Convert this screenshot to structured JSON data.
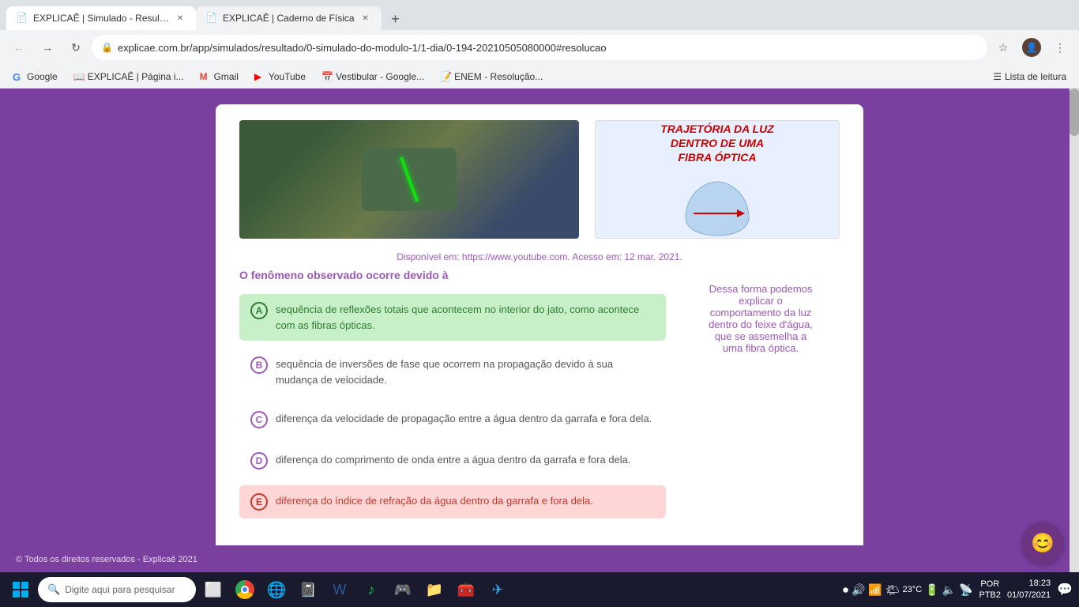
{
  "browser": {
    "tabs": [
      {
        "id": "tab1",
        "title": "EXPLICAÊ | Simulado - Resultado",
        "favicon": "📄",
        "active": true
      },
      {
        "id": "tab2",
        "title": "EXPLICAÊ | Caderno de Física",
        "favicon": "📄",
        "active": false
      }
    ],
    "url": "explicae.com.br/app/simulados/resultado/0-simulado-do-modulo-1/1-dia/0-194-20210505080000#resolucao",
    "new_tab_icon": "+",
    "bookmarks": [
      {
        "label": "Google",
        "favicon": "G"
      },
      {
        "label": "EXPLICAÊ | Página i...",
        "favicon": "📖"
      },
      {
        "label": "Gmail",
        "favicon": "M"
      },
      {
        "label": "YouTube",
        "favicon": "▶"
      },
      {
        "label": "Vestibular - Google...",
        "favicon": "📅"
      },
      {
        "label": "ENEM - Resolução...",
        "favicon": "📝"
      }
    ],
    "reading_list": "Lista de leitura"
  },
  "question": {
    "citation": "Disponível em: https://www.youtube.com. Acesso em: 12 mar. 2021.",
    "question_text": "O fenômeno observado ocorre devido à",
    "options": [
      {
        "letter": "A",
        "text": "sequência de reflexões totais que acontecem no interior do jato, como acontece com as fibras ópticas.",
        "state": "correct"
      },
      {
        "letter": "B",
        "text": "sequência de inversões de fase que ocorrem na propagação devido à sua mudança de velocidade.",
        "state": "neutral"
      },
      {
        "letter": "C",
        "text": "diferença da velocidade de propagação entre a água dentro da garrafa e fora dela.",
        "state": "neutral"
      },
      {
        "letter": "D",
        "text": "diferença do comprimento de onda entre a água dentro da garrafa e fora dela.",
        "state": "neutral"
      },
      {
        "letter": "E",
        "text": "diferença do índice de refração da água dentro da garrafa e fora dela.",
        "state": "wrong"
      }
    ],
    "right_panel_title": "TRAJETÓRIA DA LUZ\nDENTRO DE UMA\nFIBRA ÓPTICA",
    "right_panel_explanation": "Dessa forma podemos explicar o comportamento da luz dentro do feixe d'água, que se assemelha a uma fibra óptica."
  },
  "footer": {
    "text": "© Todos os direitos reservados - Explicaê 2021"
  },
  "taskbar": {
    "search_placeholder": "Digite aqui para pesquisar",
    "temperature": "23°C",
    "time": "18:23",
    "date": "01/07/2021",
    "language": "POR",
    "keyboard": "PTB2",
    "notification_text": ""
  },
  "icons": {
    "back": "←",
    "forward": "→",
    "reload": "↻",
    "star": "☆",
    "menu": "⋮",
    "lock": "🔒",
    "search": "🔍",
    "chat": "😊"
  }
}
